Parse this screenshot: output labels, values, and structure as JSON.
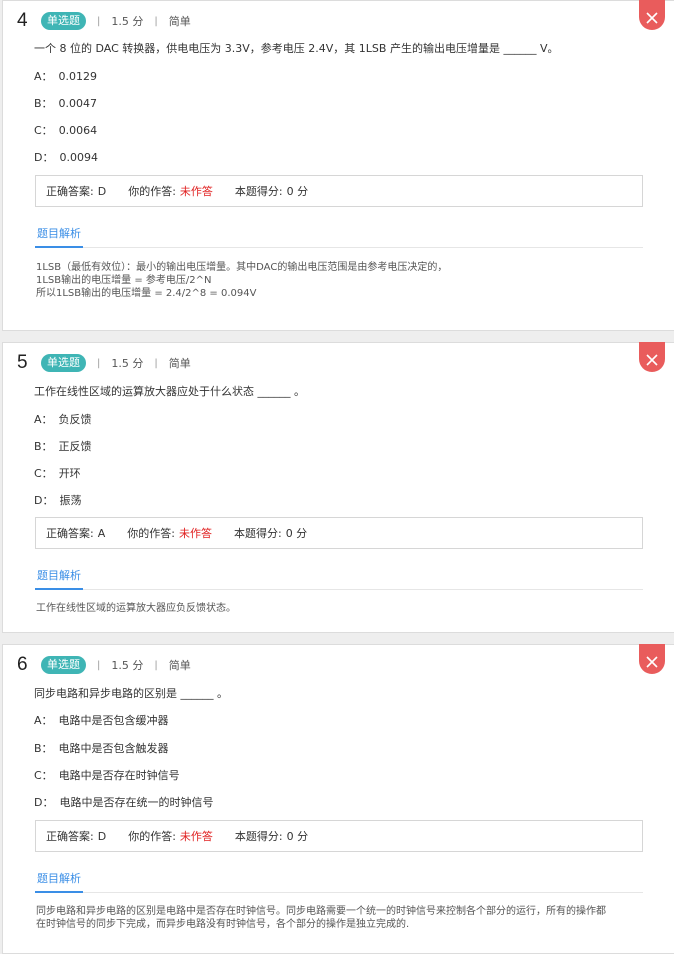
{
  "questions": [
    {
      "number": "4",
      "type": "单选题",
      "score": "1.5 分",
      "difficulty": "简单",
      "stem": "一个 8 位的 DAC 转换器，供电电压为 3.3V，参考电压 2.4V，其 1LSB 产生的输出电压增量是 ______ V。",
      "options": [
        {
          "letter": "A：",
          "text": "0.0129"
        },
        {
          "letter": "B：",
          "text": "0.0047"
        },
        {
          "letter": "C：",
          "text": "0.0064"
        },
        {
          "letter": "D：",
          "text": "0.0094"
        }
      ],
      "correct_label": "正确答案:",
      "correct_value": "D",
      "your_label": "你的作答:",
      "your_value": "未作答",
      "score_label": "本题得分:",
      "score_value": "0 分",
      "analysis_tab": "题目解析",
      "analysis_lines": [
        "1LSB（最低有效位）：最小的输出电压增量。其中DAC的输出电压范围是由参考电压决定的，",
        "1LSB输出的电压增量 = 参考电压/2^N",
        "所以1LSB输出的电压增量 = 2.4/2^8 = 0.094V"
      ]
    },
    {
      "number": "5",
      "type": "单选题",
      "score": "1.5 分",
      "difficulty": "简单",
      "stem": "工作在线性区域的运算放大器应处于什么状态 ______ 。",
      "options": [
        {
          "letter": "A：",
          "text": "负反馈"
        },
        {
          "letter": "B：",
          "text": "正反馈"
        },
        {
          "letter": "C：",
          "text": "开环"
        },
        {
          "letter": "D：",
          "text": "振荡"
        }
      ],
      "correct_label": "正确答案:",
      "correct_value": "A",
      "your_label": "你的作答:",
      "your_value": "未作答",
      "score_label": "本题得分:",
      "score_value": "0 分",
      "analysis_tab": "题目解析",
      "analysis_lines": [
        "工作在线性区域的运算放大器应负反馈状态。"
      ]
    },
    {
      "number": "6",
      "type": "单选题",
      "score": "1.5 分",
      "difficulty": "简单",
      "stem": "同步电路和异步电路的区别是 ______ 。",
      "options": [
        {
          "letter": "A：",
          "text": "电路中是否包含缓冲器"
        },
        {
          "letter": "B：",
          "text": "电路中是否包含触发器"
        },
        {
          "letter": "C：",
          "text": "电路中是否存在时钟信号"
        },
        {
          "letter": "D：",
          "text": "电路中是否存在统一的时钟信号"
        }
      ],
      "correct_label": "正确答案:",
      "correct_value": "D",
      "your_label": "你的作答:",
      "your_value": "未作答",
      "score_label": "本题得分:",
      "score_value": "0 分",
      "analysis_tab": "题目解析",
      "analysis_lines": [
        "同步电路和异步电路的区别是电路中是否存在时钟信号。同步电路需要一个统一的时钟信号来控制各个部分的运行，所有的操作都",
        "在时钟信号的同步下完成，而异步电路没有时钟信号，各个部分的操作是独立完成的."
      ]
    }
  ],
  "colors": {
    "badge": "#3fb5b5",
    "close": "#e95c5c",
    "unanswered": "#e02020",
    "tab_accent": "#3a8ee6"
  },
  "icons": {
    "close": "close-icon"
  }
}
